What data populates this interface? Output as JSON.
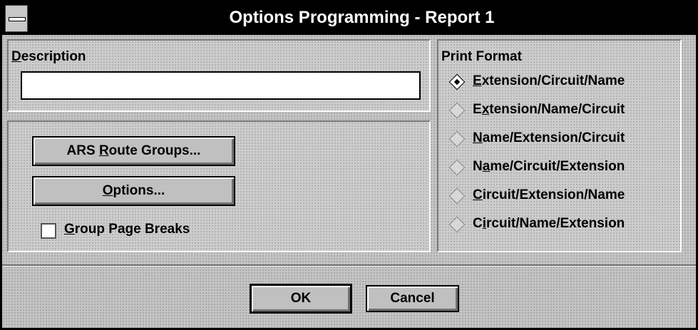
{
  "window": {
    "title": "Options Programming - Report 1"
  },
  "description": {
    "label_first": "D",
    "label_rest": "escription",
    "value": ""
  },
  "buttons": {
    "ars_a": "ARS ",
    "ars_u": "R",
    "ars_b": "oute Groups...",
    "opt_u": "O",
    "opt_b": "ptions...",
    "ok": "OK",
    "cancel": "Cancel"
  },
  "group_breaks": {
    "u": "G",
    "rest": "roup Page Breaks",
    "checked": false
  },
  "print_format": {
    "title": "Print Format",
    "options": [
      {
        "pre": "",
        "u": "E",
        "post": "xtension/Circuit/Name",
        "selected": true
      },
      {
        "pre": "E",
        "u": "x",
        "post": "tension/Name/Circuit",
        "selected": false
      },
      {
        "pre": "",
        "u": "N",
        "post": "ame/Extension/Circuit",
        "selected": false
      },
      {
        "pre": "N",
        "u": "a",
        "post": "me/Circuit/Extension",
        "selected": false
      },
      {
        "pre": "",
        "u": "C",
        "post": "ircuit/Extension/Name",
        "selected": false
      },
      {
        "pre": "C",
        "u": "i",
        "post": "rcuit/Name/Extension",
        "selected": false
      }
    ]
  }
}
